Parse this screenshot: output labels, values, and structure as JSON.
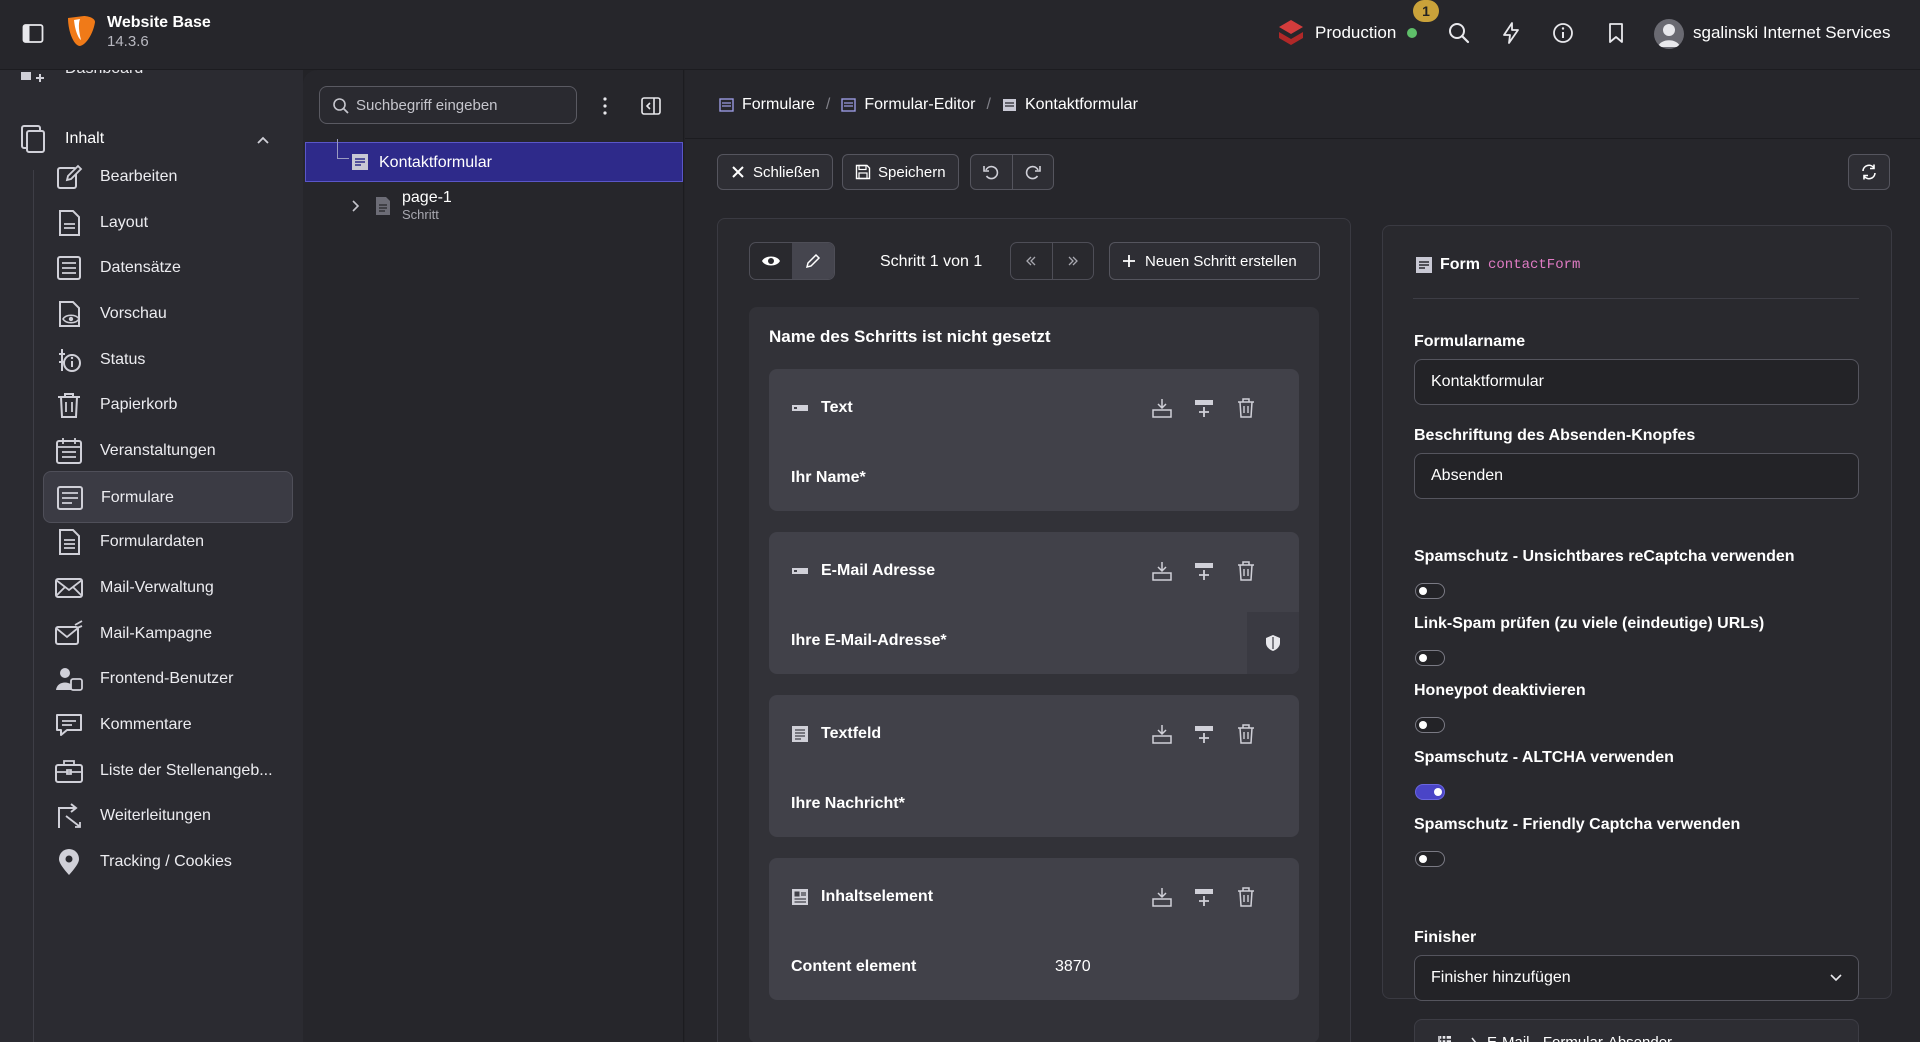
{
  "topbar": {
    "site_name": "Website Base",
    "site_version": "14.3.6",
    "environment": "Production",
    "notification_count": "1",
    "user_name": "sgalinski Internet Services"
  },
  "modnav": {
    "dashboard_label": "Dashboard",
    "group_label": "Inhalt",
    "items": [
      {
        "label": "Bearbeiten",
        "icon": "edit-icon"
      },
      {
        "label": "Layout",
        "icon": "layout-icon"
      },
      {
        "label": "Datensätze",
        "icon": "list-icon"
      },
      {
        "label": "Vorschau",
        "icon": "preview-icon"
      },
      {
        "label": "Status",
        "icon": "status-icon"
      },
      {
        "label": "Papierkorb",
        "icon": "trash-icon"
      },
      {
        "label": "Veranstaltungen",
        "icon": "calendar-icon"
      },
      {
        "label": "Formulare",
        "icon": "form-icon"
      },
      {
        "label": "Formulardaten",
        "icon": "form-data-icon"
      },
      {
        "label": "Mail-Verwaltung",
        "icon": "mail-icon"
      },
      {
        "label": "Mail-Kampagne",
        "icon": "mail-campaign-icon"
      },
      {
        "label": "Frontend-Benutzer",
        "icon": "users-icon"
      },
      {
        "label": "Kommentare",
        "icon": "comments-icon"
      },
      {
        "label": "Liste der Stellenangeb...",
        "icon": "briefcase-icon"
      },
      {
        "label": "Weiterleitungen",
        "icon": "redirect-icon"
      },
      {
        "label": "Tracking / Cookies",
        "icon": "location-icon"
      }
    ],
    "active_item": "Formulare"
  },
  "tree": {
    "search_placeholder": "Suchbegriff eingeben",
    "root_label": "Kontaktformular",
    "child_label": "page-1",
    "child_sub": "Schritt"
  },
  "breadcrumbs": [
    "Formulare",
    "Formular-Editor",
    "Kontaktformular"
  ],
  "toolbar": {
    "close_label": "Schließen",
    "save_label": "Speichern"
  },
  "stage": {
    "step_label": "Schritt 1 von 1",
    "new_step_label": "Neuen Schritt erstellen",
    "page_title": "Name des Schritts ist nicht gesetzt",
    "elements": [
      {
        "type": "Text",
        "field": "Ihr Name*",
        "value": "",
        "icon": "text-field-icon"
      },
      {
        "type": "E-Mail Adresse",
        "field": "Ihre E-Mail-Adresse*",
        "value": "",
        "icon": "email-field-icon"
      },
      {
        "type": "Textfeld",
        "field": "Ihre Nachricht*",
        "value": "",
        "icon": "textarea-icon"
      },
      {
        "type": "Inhaltselement",
        "field": "Content element",
        "value": "3870",
        "icon": "content-element-icon"
      }
    ]
  },
  "inspector": {
    "heading": "Form",
    "identifier": "contactForm",
    "form_name_label": "Formularname",
    "form_name_value": "Kontaktformular",
    "submit_label_label": "Beschriftung des Absenden-Knopfes",
    "submit_label_value": "Absenden",
    "toggles": [
      {
        "label": "Spamschutz - Unsichtbares reCaptcha verwenden",
        "on": false
      },
      {
        "label": "Link-Spam prüfen (zu viele (eindeutige) URLs)",
        "on": false
      },
      {
        "label": "Honeypot deaktivieren",
        "on": false
      },
      {
        "label": "Spamschutz - ALTCHA verwenden",
        "on": true
      },
      {
        "label": "Spamschutz - Friendly Captcha verwenden",
        "on": false
      }
    ],
    "finisher_label": "Finisher",
    "finisher_select": "Finisher hinzufügen",
    "finisher_item": "E-Mail - Formular-Absender"
  },
  "colors": {
    "accent": "#4a45c7",
    "active_tree": "#2e2a8a",
    "identifier": "#e07bc4",
    "env_dot": "#5fbf6a",
    "notification": "#caa23a"
  }
}
